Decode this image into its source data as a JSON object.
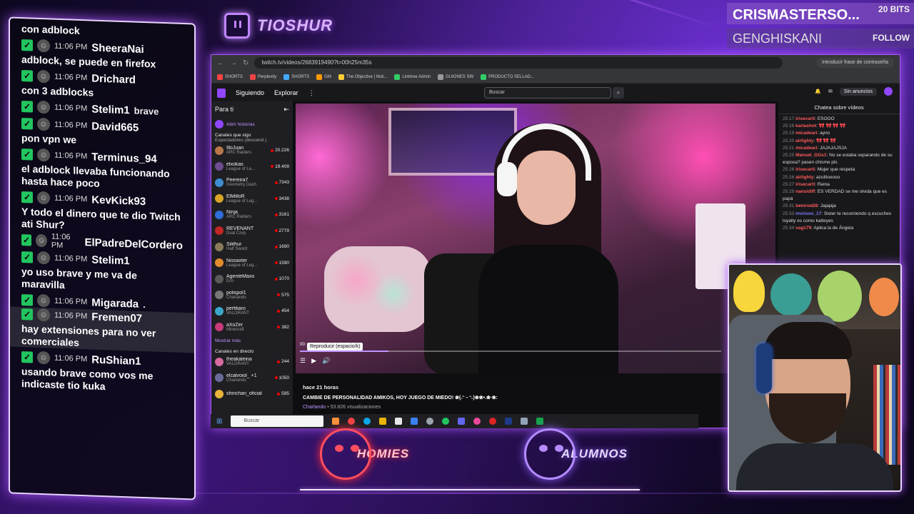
{
  "brand": {
    "name": "TIOSHUR"
  },
  "alerts": {
    "top_name": "CRISMASTERSO...",
    "top_tag": "20 BITS",
    "second_name": "GENGHISKANI",
    "second_tag": "FOLLOW"
  },
  "overlay_chat": [
    {
      "id": 0,
      "user": "",
      "time": "",
      "inline": "",
      "body": "con adblock"
    },
    {
      "id": 1,
      "user": "SheeraNai",
      "time": "11:06 PM",
      "inline": "",
      "body": "adblock, se puede en firefox"
    },
    {
      "id": 2,
      "user": "Drichard",
      "time": "11:06 PM",
      "inline": "",
      "body": "con 3 adblocks"
    },
    {
      "id": 3,
      "user": "Stelim1",
      "time": "11:06 PM",
      "inline": "brave",
      "body": ""
    },
    {
      "id": 4,
      "user": "David665",
      "time": "11:06 PM",
      "inline": "",
      "body": "pon vpn we"
    },
    {
      "id": 5,
      "user": "Terminus_94",
      "time": "11:06 PM",
      "inline": "",
      "body": "el adblock llevaba funcionando hasta hace poco"
    },
    {
      "id": 6,
      "user": "KevKick93",
      "time": "11:06 PM",
      "inline": "",
      "body": "Y todo el dinero que te dio Twitch ati Shur?"
    },
    {
      "id": 7,
      "user": "ElPadreDelCordero",
      "time": "11:06 PM",
      "inline": "",
      "body": ""
    },
    {
      "id": 8,
      "user": "Stelim1",
      "time": "11:06 PM",
      "inline": "",
      "body": "yo uso brave y me va de maravilla"
    },
    {
      "id": 9,
      "user": "Migarada",
      "time": "11:06 PM",
      "inline": ".",
      "body": ""
    },
    {
      "id": 10,
      "user": "Fremen07",
      "time": "11:06 PM",
      "inline": "",
      "body": "hay extensiones para no ver comerciales"
    },
    {
      "id": 11,
      "user": "RuShian1",
      "time": "11:06 PM",
      "inline": "",
      "body": "usando brave como vos me indicaste tio kuka"
    }
  ],
  "browser": {
    "url": "twitch.tv/videos/2683919490?t=00h25m35s",
    "password_pill": "Introducir frase de contraseña",
    "bookmarks": [
      "SHORTS",
      "Perplexity",
      "SHORTS",
      "GM",
      "The Objective | Noti...",
      "Linktree Admin",
      "GUIONES SW",
      "PRODUCTO SELLAD..."
    ]
  },
  "twitch": {
    "nav_following": "Siguiendo",
    "nav_browse": "Explorar",
    "search_placeholder": "Buscar",
    "no_ads": "Sin anuncios",
    "sidebar_title": "Para ti",
    "stories": "Abrir historias",
    "followed_heading": "Canales que sigo",
    "followed_sort": "Espectadores (descend.)",
    "channels": [
      {
        "name": "IlloJuan",
        "game": "ARC Raiders",
        "viewers": "20.226",
        "color": "#b9774a"
      },
      {
        "name": "elxokas",
        "game": "League of Le...",
        "viewers": "19.409",
        "color": "#6d4c8f"
      },
      {
        "name": "Peereira7",
        "game": "Geometry Dash",
        "viewers": "7343",
        "color": "#3e8ed0"
      },
      {
        "name": "ElMilloR",
        "game": "League of Leg...",
        "viewers": "3438",
        "color": "#d8a526"
      },
      {
        "name": "Ninja",
        "game": "ARC Raiders",
        "viewers": "3161",
        "color": "#2f6fd8"
      },
      {
        "name": "REVENANT",
        "game": "Dual Corp.",
        "viewers": "2779",
        "color": "#c22525"
      },
      {
        "name": "Silithur",
        "game": "Half Sword",
        "viewers": "1690",
        "color": "#8a7a5a"
      },
      {
        "name": "Nissaxter",
        "game": "League of Leg...",
        "viewers": "1590",
        "color": "#e08b2e"
      },
      {
        "name": "AgenteMaxo",
        "game": "Eco",
        "viewers": "1070",
        "color": "#5a5a5a"
      },
      {
        "name": "polispol1",
        "game": "Charlando",
        "viewers": "575",
        "color": "#777"
      },
      {
        "name": "perfiliaro",
        "game": "VALORANT",
        "viewers": "454",
        "color": "#3aa9c9"
      },
      {
        "name": "aXoZer",
        "game": "Minecraft",
        "viewers": "382",
        "color": "#c83a7a"
      }
    ],
    "show_more": "Mostrar más",
    "live_heading": "Canales en directo",
    "live_channels": [
      {
        "name": "theakaleina",
        "game": "VALORANT",
        "viewers": "244",
        "color": "#d66aa0"
      },
      {
        "name": "elcalvoiol_ +1",
        "game": "Charlando",
        "viewers": "1050",
        "color": "#6a6a9a"
      },
      {
        "name": "shinchan_oficial",
        "game": "",
        "viewers": "595",
        "color": "#e8b43a"
      }
    ],
    "player": {
      "tooltip": "Reproducir (espacio/k)",
      "time_prefix": "00:",
      "progress_fraction": 0.21
    },
    "video_info": {
      "ago": "hace 21 horas",
      "title": "CAMBIE DE PERSONALIDAD AMIKOS, HOY JUEGO DE MIEDO! ❀(˶ᵔ ᵕ ᵔ˶)❀❀•.❀∙❀:",
      "category": "Charlando",
      "views": " • 53.826 visualizaciones"
    },
    "chat_title": "Chatea sobre vídeos",
    "chat": [
      {
        "t": "25:17",
        "u": "irisecarti",
        "c": "#ff5a5a",
        "m": "ESOOO"
      },
      {
        "t": "25:18",
        "u": "karlashot",
        "c": "#ff5a5a",
        "m": "🎀 🎀 🎀 🎀"
      },
      {
        "t": "25:19",
        "u": "micadeari",
        "c": "#ff5a5a",
        "m": "ayno"
      },
      {
        "t": "25:20",
        "u": "airlighty",
        "c": "#ff5a5a",
        "m": "🎀 🎀 🎀"
      },
      {
        "t": "25:21",
        "u": "micadeari",
        "c": "#ff5a5a",
        "m": "JAJAJAJSJA"
      },
      {
        "t": "25:25",
        "u": "Manuel_GGs1",
        "c": "#ff5a5a",
        "m": "No se estaba separando de su esposa? pasen chisme pls"
      },
      {
        "t": "25:26",
        "u": "irisecarti",
        "c": "#ff5a5a",
        "m": "Mujer que respeta"
      },
      {
        "t": "25:26",
        "u": "airlighty",
        "c": "#ff5a5a",
        "m": "azulitooooo"
      },
      {
        "t": "25:27",
        "u": "irisecarti",
        "c": "#ff5a5a",
        "m": "Reina"
      },
      {
        "t": "25:29",
        "u": "nansidiff",
        "c": "#ff5a5a",
        "m": "ES VERDAD se me olvida que es papá"
      },
      {
        "t": "25:31",
        "u": "bemrod28",
        "c": "#ff5a5a",
        "m": "Jajajaja"
      },
      {
        "t": "25:33",
        "u": "mvrioso_17",
        "c": "#7b7bff",
        "m": "Sister te recomiendo q escuches loyalty es como katteyes"
      },
      {
        "t": "25:34",
        "u": "vag179",
        "c": "#ff5a5a",
        "m": "Aplica la de Ángela"
      }
    ]
  },
  "taskbar": {
    "search": "Buscar"
  },
  "bottom_logos": {
    "left": "HOMIES",
    "right": "ALUMNOS"
  }
}
